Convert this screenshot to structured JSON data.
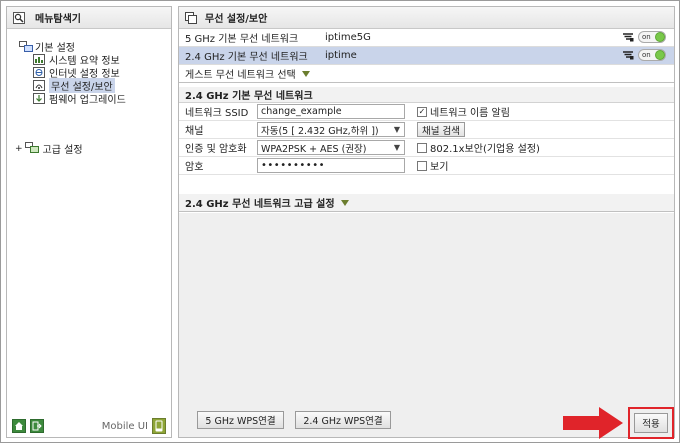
{
  "sidebar": {
    "title": "메뉴탐색기",
    "group_basic": "기본 설정",
    "items": [
      {
        "label": "시스템 요약 정보",
        "icon": "system-summary-icon"
      },
      {
        "label": "인터넷 설정 정보",
        "icon": "internet-settings-icon"
      },
      {
        "label": "무선 설정/보안",
        "icon": "wireless-icon",
        "selected": true
      },
      {
        "label": "펌웨어 업그레이드",
        "icon": "firmware-icon"
      }
    ],
    "group_advanced": "고급 설정",
    "mobile_label": "Mobile UI"
  },
  "main": {
    "title": "무선 설정/보안",
    "networks": [
      {
        "name": "5 GHz 기본 무선 네트워크",
        "ssid": "iptime5G",
        "toggle": "on",
        "selected": false
      },
      {
        "name": "2.4 GHz 기본 무선 네트워크",
        "ssid": "iptime",
        "toggle": "on",
        "selected": true
      }
    ],
    "guest_label": "게스트 무선 네트워크 선택",
    "section_title": "2.4 GHz 기본 무선 네트워크",
    "form": {
      "ssid_label": "네트워크 SSID",
      "ssid_value": "change_example",
      "broadcast_label": "네트워크 이름 알림",
      "broadcast_checked": "✓",
      "channel_label": "채널",
      "channel_value": "자동(5 [ 2.432 GHz,하위 ])",
      "channel_search": "채널 검색",
      "auth_label": "인증 및 암호화",
      "auth_value": "WPA2PSK + AES (권장)",
      "enterprise_label": "802.1x보안(기업용 설정)",
      "password_label": "암호",
      "password_value": "••••••••••",
      "show_label": "보기"
    },
    "advanced_label": "2.4 GHz 무선 네트워크 고급 설정",
    "wps5_label": "5 GHz WPS연결",
    "wps24_label": "2.4 GHz WPS연결",
    "apply_label": "적용"
  },
  "colors": {
    "selection": "#c9d4ea",
    "highlight": "#e0242a",
    "toggle_on": "#79c84a"
  }
}
